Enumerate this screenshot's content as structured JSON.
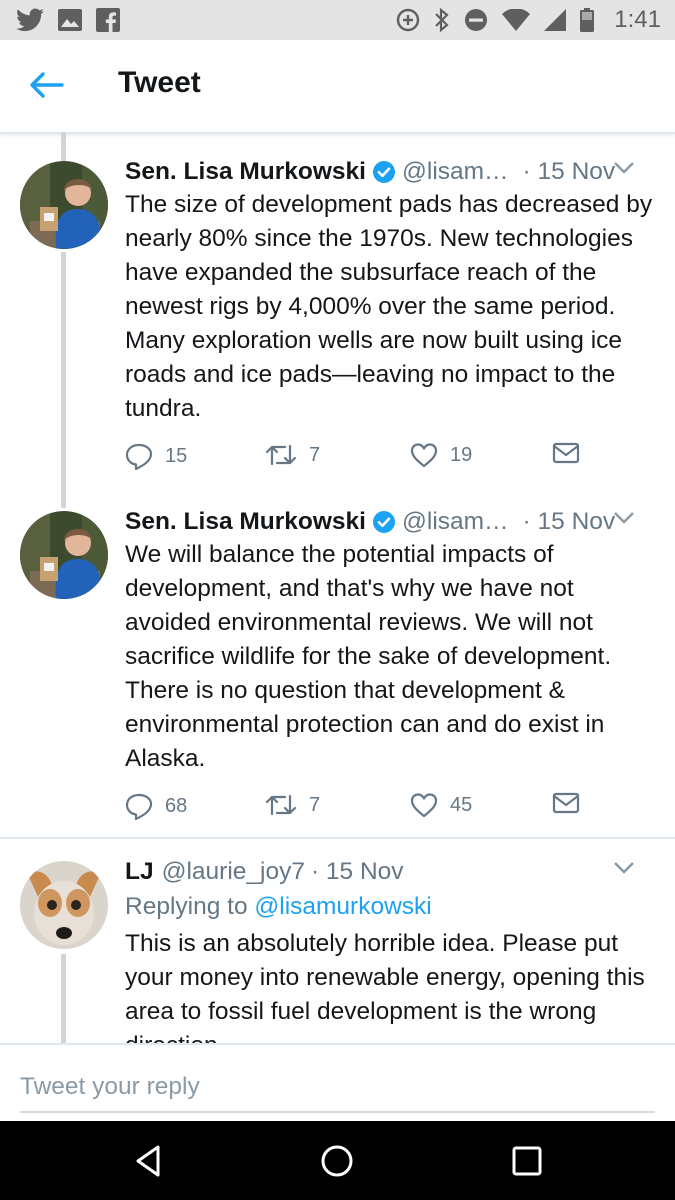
{
  "status_bar": {
    "time": "1:41"
  },
  "app_bar": {
    "title": "Tweet"
  },
  "tweets": [
    {
      "name": "Sen. Lisa Murkowski",
      "handle": "@lisam…",
      "date": "· 15 Nov",
      "verified": true,
      "text": "The size of development pads has decreased by nearly 80% since the 1970s. New technologies have expanded the subsurface reach of the newest rigs by 4,000% over the same period. Many exploration wells are now built using ice roads and ice pads—leaving no impact to the tundra.",
      "replies": "15",
      "retweets": "7",
      "likes": "19"
    },
    {
      "name": "Sen. Lisa Murkowski",
      "handle": "@lisam…",
      "date": "· 15 Nov",
      "verified": true,
      "text": "We will balance the potential impacts of development, and that's why we have not avoided environmental reviews. We will not sacrifice wildlife for the sake of development. There is no question that development & environmental protection can and do exist in Alaska.",
      "replies": "68",
      "retweets": "7",
      "likes": "45"
    },
    {
      "name": "LJ",
      "handle": "@laurie_joy7",
      "date": "· 15 Nov",
      "verified": false,
      "replying_label": "Replying to",
      "replying_to": "@lisamurkowski",
      "text": "This is an absolutely horrible idea. Please put your money into renewable energy, opening this area to fossil fuel development is the wrong direction."
    }
  ],
  "composer": {
    "placeholder": "Tweet your reply"
  },
  "colors": {
    "accent": "#1da1f2",
    "secondary_text": "#657786",
    "divider": "#e1e8ed"
  }
}
